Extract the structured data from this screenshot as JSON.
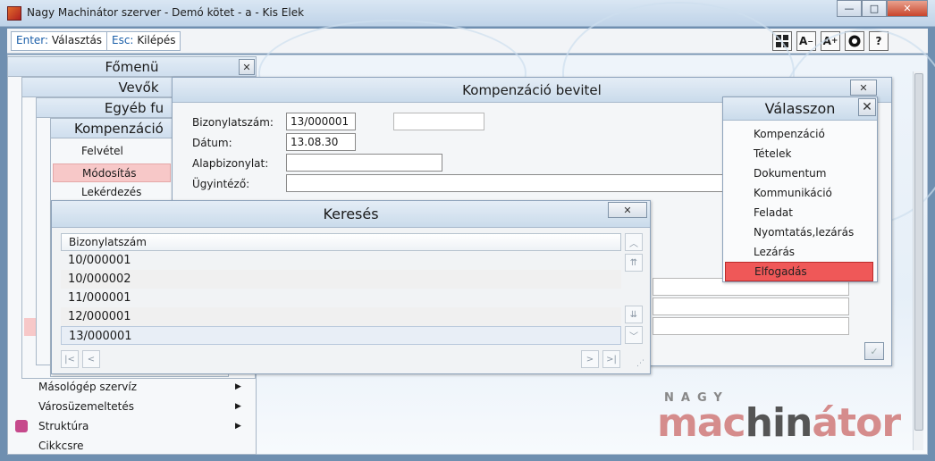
{
  "window": {
    "title": "Nagy Machinátor szerver - Demó kötet - a - Kis Elek",
    "minimize": "—",
    "maximize": "□",
    "close": "✕"
  },
  "toolbar": {
    "enter_key": "Enter:",
    "enter_label": "Választás",
    "esc_key": "Esc:",
    "esc_label": "Kilépés",
    "icons": [
      "grid-icon",
      "font-decrease-icon",
      "font-increase-icon",
      "support-icon",
      "help-icon"
    ],
    "help_label": "?",
    "fontdec_label": "A",
    "fontinc_label": "A"
  },
  "menus": {
    "main": "Főmenü",
    "customers": "Vevők",
    "other": "Egyéb fu",
    "compensation": "Kompenzáció",
    "compensation_items": [
      "Felvétel",
      "Módosítás",
      "Lekérdezés"
    ],
    "bottom_items": [
      "Másológép szervíz",
      "Városüzemeltetés",
      "Struktúra",
      "Cikkcsre"
    ]
  },
  "entry": {
    "title": "Kompenzáció bevitel",
    "close": "✕",
    "labels": {
      "doc_number": "Bizonylatszám:",
      "date": "Dátum:",
      "base_doc": "Alapbizonylat:",
      "agent": "Ügyintéző:"
    },
    "values": {
      "doc_number": "13/000001",
      "date": "13.08.30",
      "base_doc": "",
      "agent": ""
    },
    "confirm": "✓"
  },
  "search": {
    "title": "Keresés",
    "close": "✕",
    "column": "Bizonylatszám",
    "rows": [
      "10/000001",
      "10/000002",
      "11/000001",
      "12/000001",
      "13/000001"
    ],
    "selected_index": 4
  },
  "choose": {
    "title": "Válasszon",
    "close": "✕",
    "items": [
      "Kompenzáció",
      "Tételek",
      "Dokumentum",
      "Kommunikáció",
      "Feladat",
      "Nyomtatás,lezárás",
      "Lezárás",
      "Elfogadás"
    ],
    "active_index": 7
  },
  "logo": {
    "top": "NAGY",
    "part1": "mac",
    "part2": "hin",
    "part3": "átor"
  },
  "colors": {
    "active_item": "#ef5858",
    "highlight_item": "#f7c8c8",
    "logo_pink": "#d58c8c"
  }
}
